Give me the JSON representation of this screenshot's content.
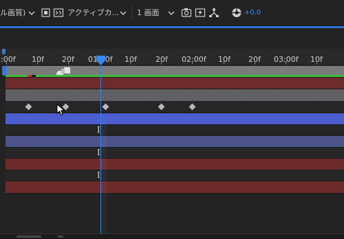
{
  "toolbar": {
    "resolution_label": "ル画質)",
    "camera_dropdown": "アクティブカ...",
    "views_dropdown": "1 画面",
    "exposure_value": "+0.0"
  },
  "timeline": {
    "ruler_labels": [
      ":00f",
      "10f",
      "20f",
      "01:00f",
      "10f",
      "20f",
      "02:00f",
      "10f",
      "20f",
      "03:00f",
      "10f"
    ]
  },
  "icons": {
    "grid": "grid-toggle-icon",
    "mask": "transparency-grid-icon",
    "snapshot": "snapshot-icon",
    "show_snapshot": "show-snapshot-icon",
    "channel": "channel-icon",
    "exposure": "exposure-reset-icon",
    "playhead": "current-time-indicator-icon",
    "keyframe": "keyframe-icon",
    "cursor": "mouse-pointer-icon"
  },
  "colors": {
    "accent_blue": "#2f6fd6",
    "layer_red": "#6d2b2b",
    "layer_blue": "#4c5489",
    "layer_blue_selected": "#4d5fd0",
    "cache_green": "#3dbd3d"
  }
}
